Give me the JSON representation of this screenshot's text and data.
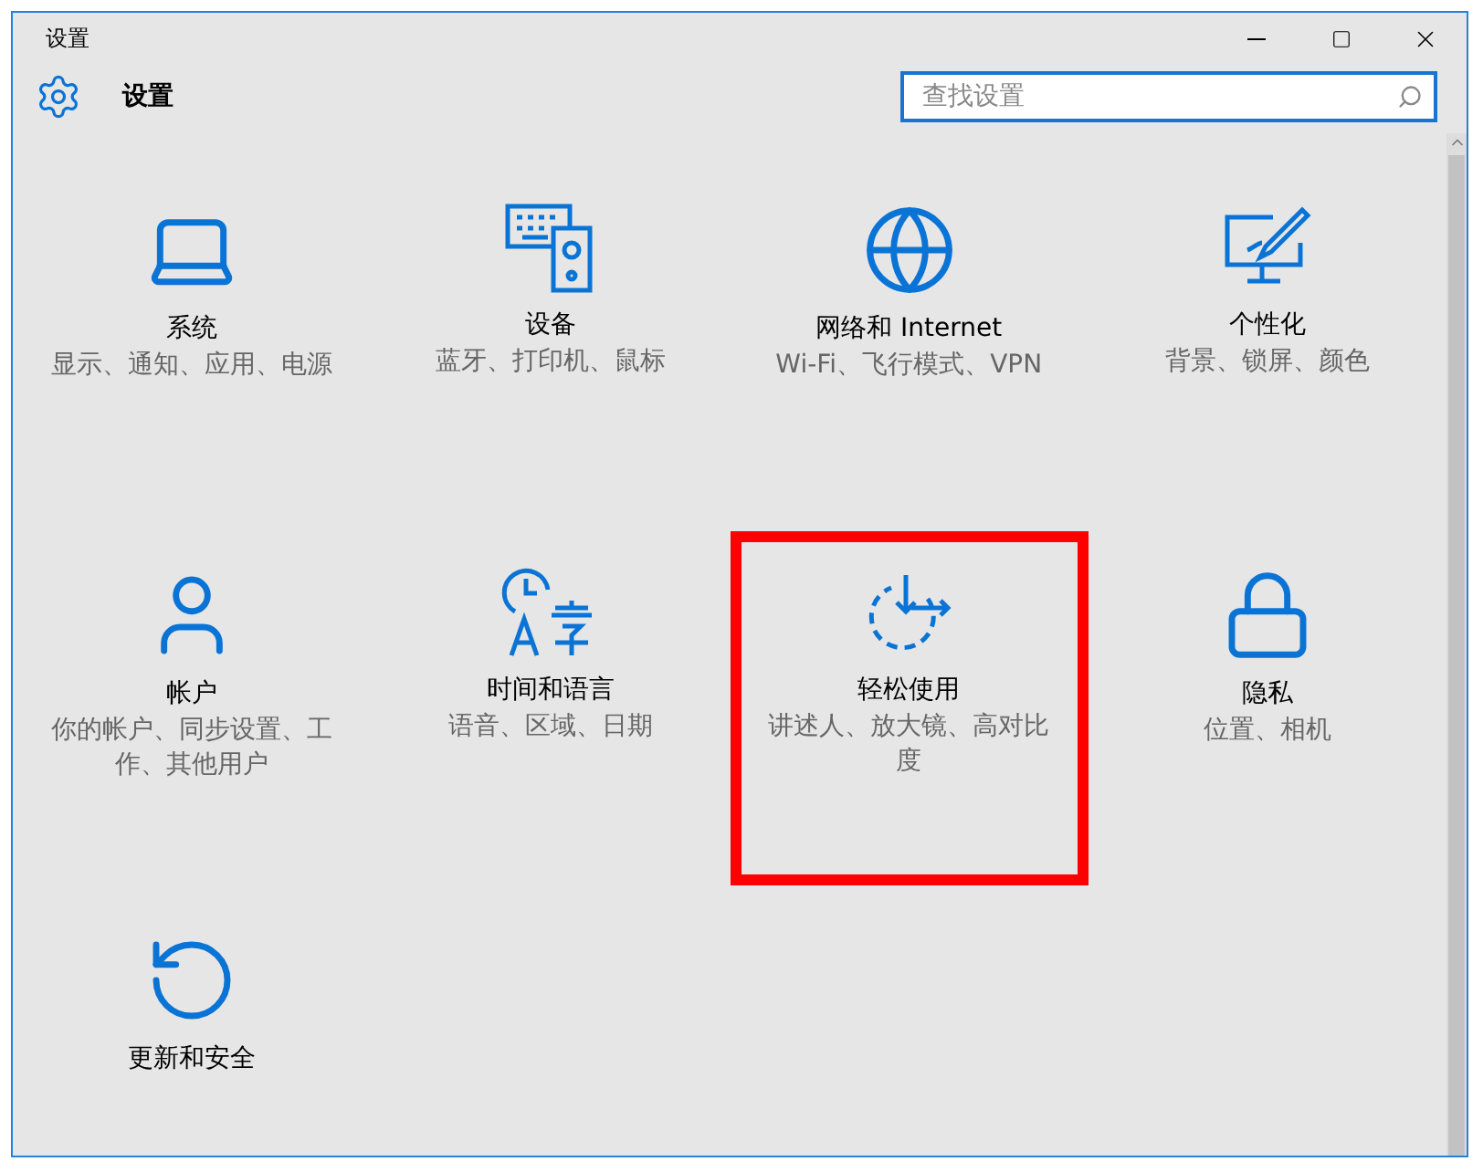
{
  "window": {
    "title": "设置"
  },
  "header": {
    "title": "设置",
    "search": {
      "placeholder": "查找设置"
    }
  },
  "categories": [
    {
      "kind": "laptop",
      "title": "系统",
      "description": "显示、通知、应用、电源",
      "highlighted": false
    },
    {
      "kind": "devices",
      "title": "设备",
      "description": "蓝牙、打印机、鼠标",
      "highlighted": false
    },
    {
      "kind": "globe",
      "title": "网络和 Internet",
      "description": "Wi-Fi、飞行模式、VPN",
      "highlighted": false
    },
    {
      "kind": "personalize",
      "title": "个性化",
      "description": "背景、锁屏、颜色",
      "highlighted": false
    },
    {
      "kind": "user",
      "title": "帐户",
      "description": "你的帐户、同步设置、工作、其他用户",
      "highlighted": false
    },
    {
      "kind": "time",
      "title": "时间和语言",
      "description": "语音、区域、日期",
      "highlighted": false
    },
    {
      "kind": "ease",
      "title": "轻松使用",
      "description": "讲述人、放大镜、高对比度",
      "highlighted": true
    },
    {
      "kind": "lock",
      "title": "隐私",
      "description": "位置、相机",
      "highlighted": false
    },
    {
      "kind": "update",
      "title": "更新和安全",
      "highlighted": false
    }
  ]
}
